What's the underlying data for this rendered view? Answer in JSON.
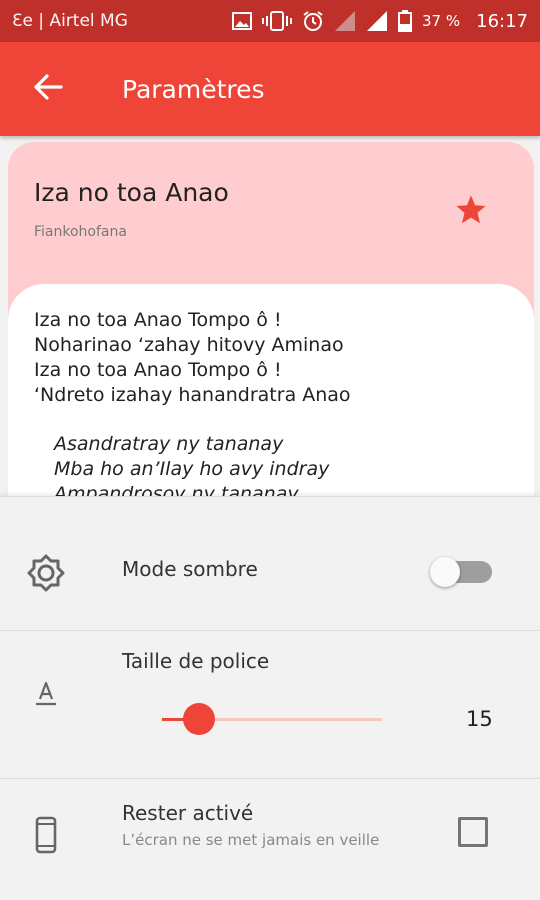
{
  "status_bar": {
    "carrier": "Ɛe | Airtel MG",
    "battery": "37 %",
    "time": "16:17"
  },
  "app_bar": {
    "title": "Paramètres"
  },
  "preview": {
    "title": "Iza no toa Anao",
    "subtitle": "Fiankohofana",
    "lyrics": [
      "Iza no toa Anao Tompo ô !",
      "Noharinao ‘zahay hitovy Aminao",
      "Iza no toa Anao Tompo ô !",
      "‘Ndreto izahay hanandratra Anao"
    ],
    "chorus": [
      "Asandratray ny tananay",
      "Mba ho an’Ilay ho avy indray",
      "Ampandrosoy ny tananay"
    ]
  },
  "settings": {
    "dark_mode": {
      "label": "Mode sombre",
      "enabled": false
    },
    "font_size": {
      "label": "Taille de police",
      "value": "15",
      "slider_fraction": 0.17
    },
    "stay_awake": {
      "label": "Rester activé",
      "description": "L’écran ne se met jamais en veille",
      "checked": false
    }
  },
  "colors": {
    "primary": "#ef4438",
    "status_bar": "#c0302a",
    "card_pink": "#ffcdd0"
  }
}
